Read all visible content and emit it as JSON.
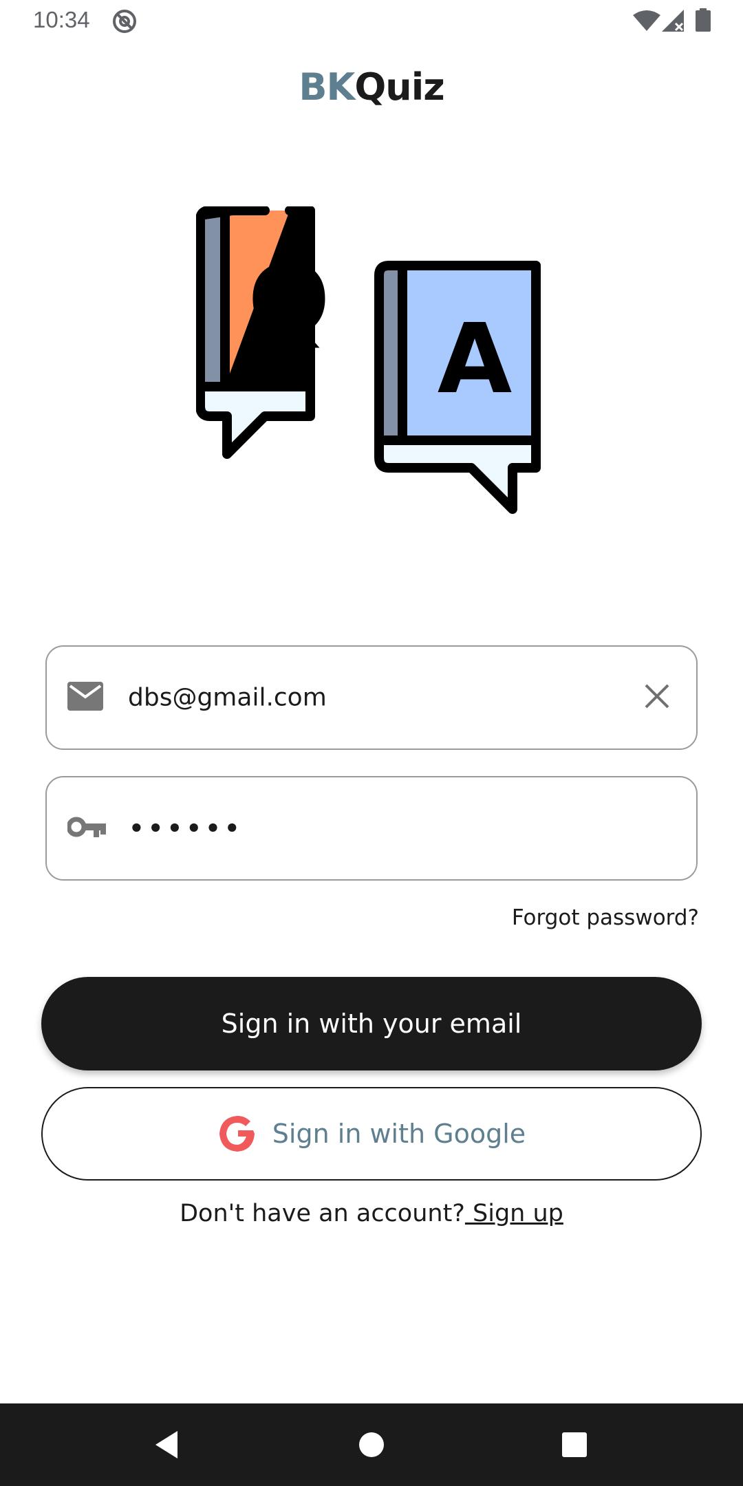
{
  "status_bar": {
    "time": "10:34",
    "icons": [
      "at-sign-icon",
      "wifi-icon",
      "cell-signal-icon",
      "battery-icon"
    ]
  },
  "app": {
    "title_part1": "BK",
    "title_part2": "Quiz"
  },
  "illustration": {
    "icon": "qa-books-icon",
    "left_letter": "Q",
    "right_letter": "A"
  },
  "email_field": {
    "icon": "mail-icon",
    "value": "dbs@gmail.com",
    "clear_icon": "close-icon"
  },
  "password_field": {
    "icon": "key-icon",
    "value": "••••••"
  },
  "links": {
    "forgot_password": "Forgot password?",
    "no_account": "Don't have an account?",
    "sign_up": " Sign up"
  },
  "buttons": {
    "email_signin": "Sign in with your email",
    "google_signin": "Sign in with Google"
  },
  "nav_bar": {
    "icons": [
      "back-icon",
      "home-icon",
      "recents-icon"
    ]
  },
  "colors": {
    "accent": "#5e7f8f",
    "primary_button": "#1b1b1b",
    "google_red": "#f05a5a",
    "book_orange": "#ff9259",
    "book_blue": "#a8caff",
    "book_spine": "#8391a6"
  }
}
